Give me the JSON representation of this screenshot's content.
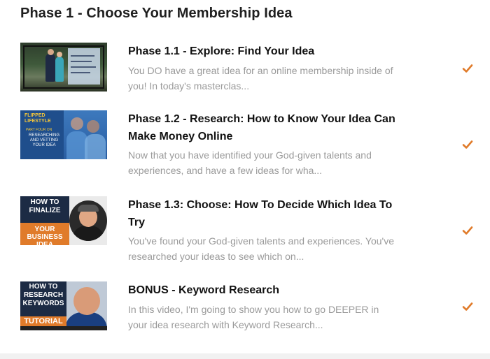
{
  "section": {
    "title": "Phase 1 - Choose Your Membership Idea"
  },
  "lessons": [
    {
      "title": "Phase 1.1 - Explore: Find Your Idea",
      "description_line1": "You DO have a great idea for an online membership inside of",
      "description_line2": "you!  In today's masterclas..."
    },
    {
      "title_line1": "Phase 1.2 - Research: How to Know Your Idea Can",
      "title_line2": "Make Money Online",
      "description_line1": "Now that you have identified your God-given talents and",
      "description_line2": "experiences, and have a few ideas for wha...",
      "thumb": {
        "brand_line1": "FLIPPED",
        "brand_line2": "LIFESTYLE",
        "sub": "PART FOUR ON",
        "topic": "RESEARCHING AND VETTING YOUR IDEA"
      }
    },
    {
      "title_line1": "Phase 1.3: Choose: How To Decide Which Idea To",
      "title_line2": "Try",
      "description_line1": "You've found your God-given talents and experiences. You've",
      "description_line2": "researched your ideas to see which on...",
      "thumb": {
        "top": "HOW TO FINALIZE",
        "bottom": "YOUR BUSINESS IDEA"
      }
    },
    {
      "title": "BONUS - Keyword Research",
      "description_line1": "In this video, I'm going to show you how to go DEEPER in",
      "description_line2": "your idea research with Keyword Research...",
      "thumb": {
        "title": "HOW TO RESEARCH KEYWORDS",
        "banner": "TUTORIAL"
      }
    }
  ],
  "colors": {
    "check": "#e07b2a",
    "title": "#111111",
    "description": "#9a9a9a"
  },
  "icons": {
    "completed": "checkmark-icon"
  }
}
